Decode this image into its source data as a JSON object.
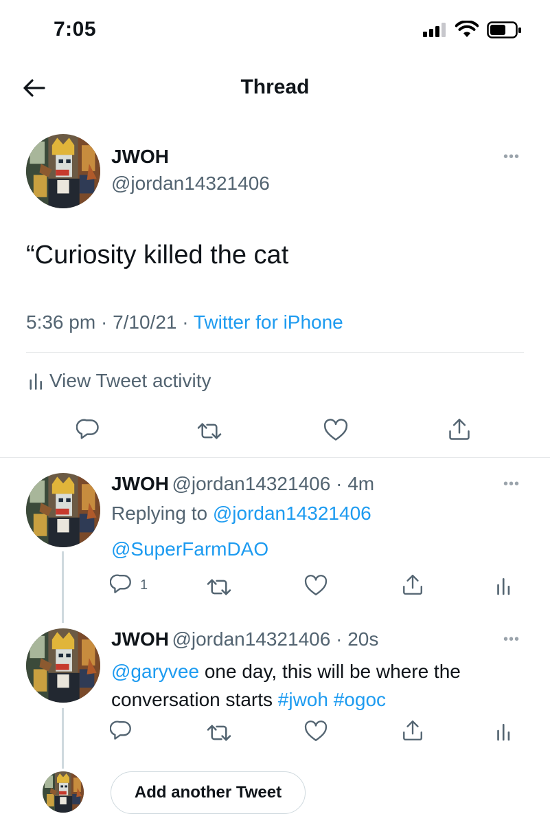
{
  "status_bar": {
    "time": "7:05"
  },
  "header": {
    "title": "Thread"
  },
  "main_tweet": {
    "name": "JWOH",
    "handle": "@jordan14321406",
    "text": "“Curiosity killed the cat",
    "time": "5:36 pm",
    "date": "7/10/21",
    "source": "Twitter for iPhone",
    "activity_label": "View Tweet activity"
  },
  "replies": [
    {
      "name": "JWOH",
      "handle": "@jordan14321406",
      "age": "4m",
      "replying_prefix": "Replying to",
      "replying_to": "@jordan14321406",
      "text_mention": "@SuperFarmDAO",
      "reply_count": "1"
    },
    {
      "name": "JWOH",
      "handle": "@jordan14321406",
      "age": "20s",
      "mention": "@garyvee",
      "text_part1": " one day, this will be where the",
      "text_part2": "conversation starts ",
      "tag1": "#jwoh",
      "tag2": "#ogoc"
    }
  ],
  "composer": {
    "add_label": "Add another Tweet"
  },
  "colors": {
    "link": "#1d9bf0",
    "secondary": "#536471",
    "text": "#0f1419"
  },
  "icons": [
    "back-arrow-icon",
    "cellular-signal-icon",
    "wifi-icon",
    "battery-icon",
    "more-icon",
    "reply-icon",
    "retweet-icon",
    "like-icon",
    "share-icon",
    "activity-icon"
  ]
}
